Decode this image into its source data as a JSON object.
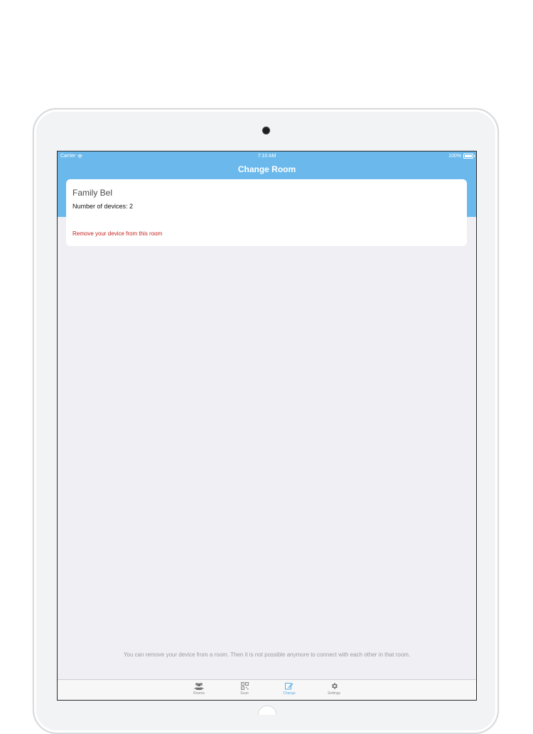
{
  "status_bar": {
    "carrier": "Carrier",
    "time": "7:10 AM",
    "battery": "100%"
  },
  "nav": {
    "title": "Change Room"
  },
  "room": {
    "name": "Family Bel",
    "device_count_label": "Number of devices: 2",
    "remove_label": "Remove your device from this room"
  },
  "footer_note": "You can remove your device from a room. Then it is not possible anymore to connect with each other in that room.",
  "tabs": [
    {
      "label": "Rooms",
      "icon": "people-icon",
      "active": false
    },
    {
      "label": "Scan",
      "icon": "qr-code-icon",
      "active": false
    },
    {
      "label": "Change",
      "icon": "edit-icon",
      "active": true
    },
    {
      "label": "Settings",
      "icon": "gear-icon",
      "active": false
    }
  ],
  "colors": {
    "accent": "#6bb9ec",
    "danger": "#c0241f",
    "active_tab": "#5aaee6",
    "background": "#efeff4"
  }
}
